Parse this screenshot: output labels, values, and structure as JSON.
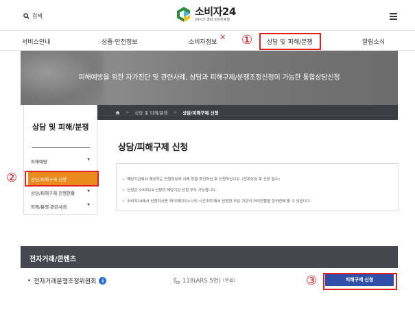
{
  "header": {
    "search_label": "검색",
    "logo_name": "소비자24",
    "logo_sub": "24시간 열린 소비자포털"
  },
  "nav": {
    "items": [
      {
        "label": "서비스안내"
      },
      {
        "label": "상품·안전정보"
      },
      {
        "label": "소비자정보"
      },
      {
        "label": "상담 및 피해/분쟁"
      },
      {
        "label": "알림소식"
      }
    ]
  },
  "annotations": {
    "marker_1": "①",
    "marker_2": "②",
    "marker_3": "③"
  },
  "banner": {
    "text": "피해예방을 위한 자가진단 및 관련사례, 상담과 피해구제/분쟁조정신청이 가능한 통합상담신청"
  },
  "breadcrumb": {
    "items": [
      "상담 및 피해/분쟁",
      "상담/피해구제 신청"
    ]
  },
  "sidebar": {
    "title": "상담 및 피해/분쟁",
    "items": [
      {
        "label": "피해예방",
        "active": false
      },
      {
        "label": "상담/피해구제 신청",
        "active": true
      },
      {
        "label": "상담/피해구제 진행현황",
        "active": false
      },
      {
        "label": "피해/분쟁 관련사례",
        "active": false
      }
    ]
  },
  "main": {
    "title": "상담/피해구제 신청",
    "notices": [
      "해당기관에서 제공하는 민원정보와 사례 등을 확인하신 후 신청하십시오. (전화상담 후 신청 필수)",
      "신청은 소비자24 신청과 해당기관 신청 모두 가능합니다.",
      "소비자24에서 신청하시면 '마이페이지>나의 시건조회'에서 신청한 모든 기관의 처리현황을 한꺼번에 볼 수 있습니다."
    ]
  },
  "ecommerce": {
    "title": "전자거래/콘텐츠",
    "org_name": "전자거래분쟁조정위원회",
    "info_icon": "i",
    "phone": "118(ARS 5번)",
    "phone_note": "(무료)",
    "apply_label": "피해구제 신청"
  },
  "colors": {
    "accent_orange": "#e88a1c",
    "highlight_red": "#e02020",
    "button_blue": "#2f4fa8",
    "dark_bar": "#46464e"
  }
}
